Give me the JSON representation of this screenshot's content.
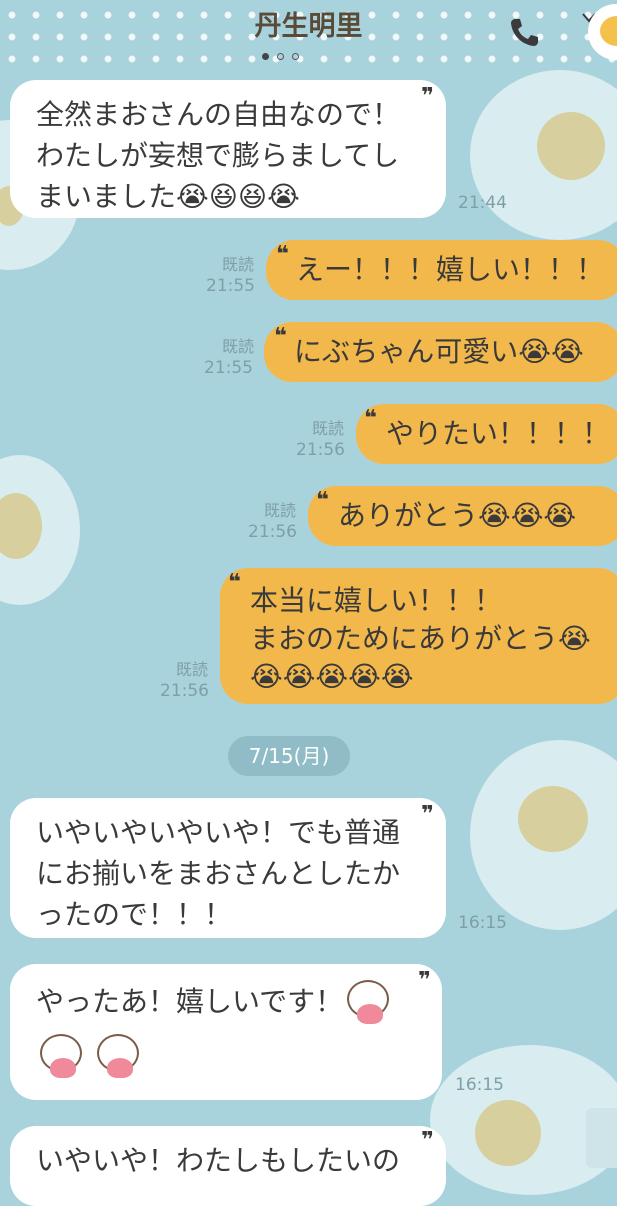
{
  "header": {
    "title": "丹生明里"
  },
  "icons": {
    "phone": "phone-icon",
    "chevron": "chevron-down-icon",
    "avatar": "avatar"
  },
  "messages": [
    {
      "dir": "in",
      "lines": [
        "全然まおさんの自由なので！",
        "わたしが妄想で膨らましてし",
        "まいました😭😆😆😭"
      ],
      "time": "21:44"
    },
    {
      "dir": "out",
      "text": "えー！！！嬉しい！！！",
      "read": "既読",
      "time": "21:55"
    },
    {
      "dir": "out",
      "text": "にぶちゃん可愛い😭😭",
      "read": "既読",
      "time": "21:55"
    },
    {
      "dir": "out",
      "text": "やりたい！！！！",
      "read": "既読",
      "time": "21:56"
    },
    {
      "dir": "out",
      "text": "ありがとう😭😭😭",
      "read": "既読",
      "time": "21:56"
    },
    {
      "dir": "out",
      "lines": [
        "本当に嬉しい！！！",
        "まおのためにありがとう😭",
        "😭😭😭😭😭"
      ],
      "read": "既読",
      "time": "21:56"
    },
    {
      "dir": "in",
      "lines": [
        "いやいやいやいや！でも普通",
        "にお揃いをまおさんとしたか",
        "ったので！！！"
      ],
      "time": "16:15"
    },
    {
      "dir": "in",
      "lines": [
        "やったあ！嬉しいです！"
      ],
      "stickers": 3,
      "time": "16:15"
    },
    {
      "dir": "in",
      "lines": [
        "いやいや！わたしもしたいの"
      ]
    }
  ],
  "date_separator": "7/15(月)",
  "colors": {
    "background": "#a9d3dc",
    "outgoing": "#f2b84c",
    "incoming": "#ffffff"
  }
}
